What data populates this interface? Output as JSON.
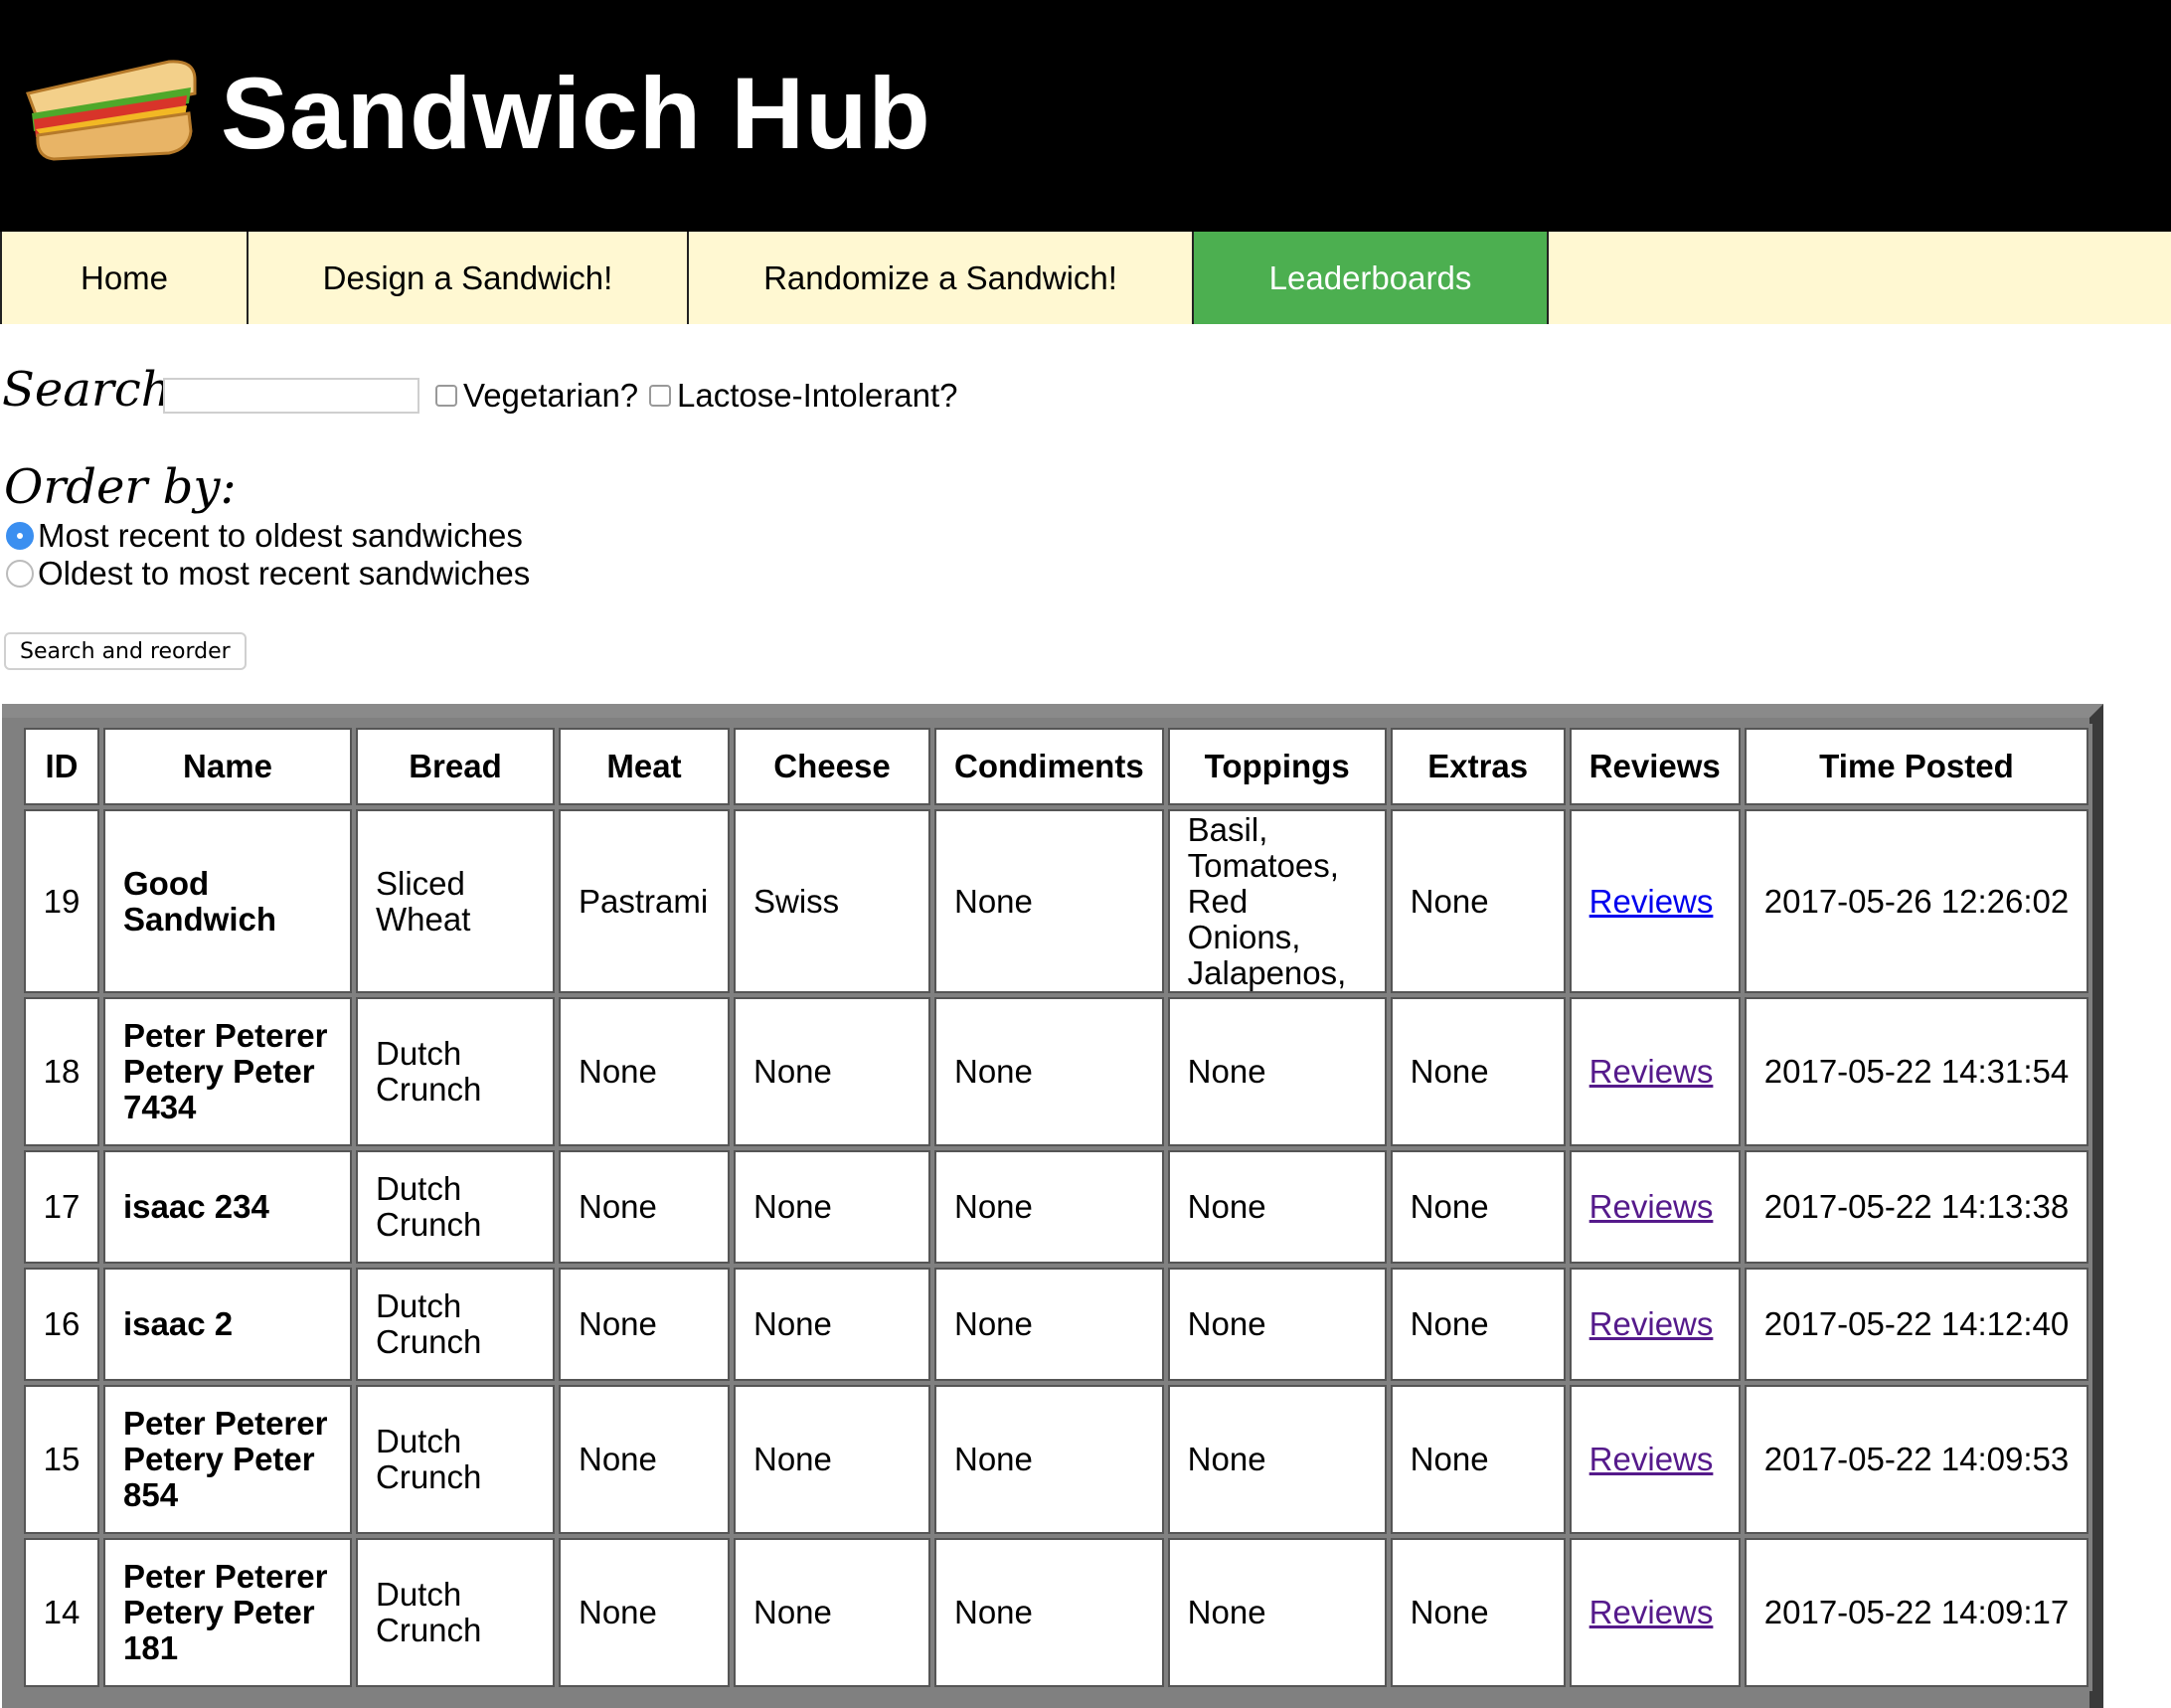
{
  "header": {
    "title": "Sandwich Hub",
    "logo_icon": "sandwich-icon"
  },
  "nav": [
    {
      "label": "Home",
      "active": false
    },
    {
      "label": "Design a Sandwich!",
      "active": false
    },
    {
      "label": "Randomize a Sandwich!",
      "active": false
    },
    {
      "label": "Leaderboards",
      "active": true
    }
  ],
  "search": {
    "label": "Search:",
    "value": "",
    "vegetarian_label": "Vegetarian?",
    "lactose_label": "Lactose-Intolerant?",
    "vegetarian_checked": false,
    "lactose_checked": false
  },
  "order": {
    "label": "Order by:",
    "options": [
      {
        "label": "Most recent to oldest sandwiches",
        "selected": true
      },
      {
        "label": "Oldest to most recent sandwiches",
        "selected": false
      }
    ]
  },
  "button": {
    "label": "Search and reorder"
  },
  "table": {
    "headers": [
      "ID",
      "Name",
      "Bread",
      "Meat",
      "Cheese",
      "Condiments",
      "Toppings",
      "Extras",
      "Reviews",
      "Time Posted"
    ],
    "rows": [
      {
        "id": "19",
        "name": "Good Sandwich",
        "bread": "Sliced Wheat",
        "meat": "Pastrami",
        "cheese": "Swiss",
        "condiments": "None",
        "toppings": "Basil, Tomatoes, Red Onions, Jalapenos,",
        "extras": "None",
        "reviews": "Reviews",
        "time": "2017-05-26 12:26:02"
      },
      {
        "id": "18",
        "name": "Peter Peterer Petery Peter 7434",
        "bread": "Dutch Crunch",
        "meat": "None",
        "cheese": "None",
        "condiments": "None",
        "toppings": "None",
        "extras": "None",
        "reviews": "Reviews",
        "time": "2017-05-22 14:31:54"
      },
      {
        "id": "17",
        "name": "isaac 234",
        "bread": "Dutch Crunch",
        "meat": "None",
        "cheese": "None",
        "condiments": "None",
        "toppings": "None",
        "extras": "None",
        "reviews": "Reviews",
        "time": "2017-05-22 14:13:38"
      },
      {
        "id": "16",
        "name": "isaac 2",
        "bread": "Dutch Crunch",
        "meat": "None",
        "cheese": "None",
        "condiments": "None",
        "toppings": "None",
        "extras": "None",
        "reviews": "Reviews",
        "time": "2017-05-22 14:12:40"
      },
      {
        "id": "15",
        "name": "Peter Peterer Petery Peter 854",
        "bread": "Dutch Crunch",
        "meat": "None",
        "cheese": "None",
        "condiments": "None",
        "toppings": "None",
        "extras": "None",
        "reviews": "Reviews",
        "time": "2017-05-22 14:09:53"
      },
      {
        "id": "14",
        "name": "Peter Peterer Petery Peter 181",
        "bread": "Dutch Crunch",
        "meat": "None",
        "cheese": "None",
        "condiments": "None",
        "toppings": "None",
        "extras": "None",
        "reviews": "Reviews",
        "time": "2017-05-22 14:09:17"
      }
    ]
  },
  "colors": {
    "header_bg": "#000000",
    "nav_bg": "#fff8d2",
    "active_nav": "#4caf50",
    "link_visited": "#551a8b",
    "link": "#0000ee"
  }
}
